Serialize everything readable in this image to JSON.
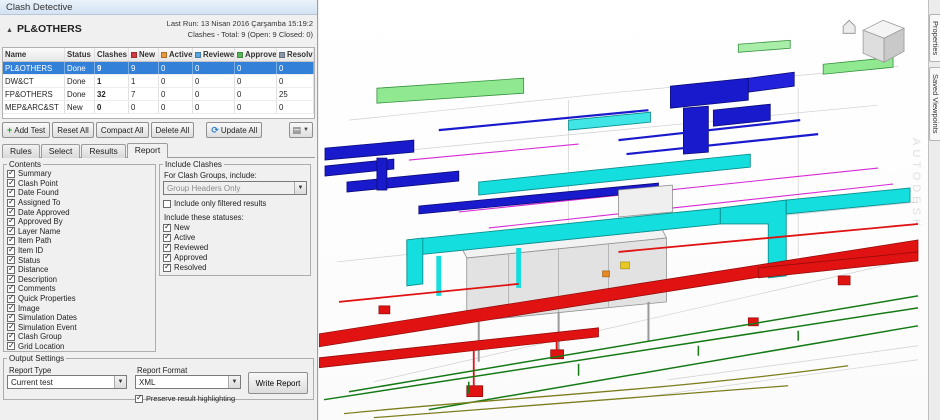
{
  "window": {
    "title": "Clash Detective"
  },
  "header": {
    "collapse_icon": "▲",
    "test_name": "PL&OTHERS",
    "last_run": "Last Run: 13 Nisan 2016 Çarşamba 15:19:2",
    "summary": "Clashes - Total: 9 (Open: 9 Closed: 0)"
  },
  "table": {
    "columns": [
      "Name",
      "Status",
      "Clashes",
      "New",
      "Active",
      "Reviewed",
      "Approved",
      "Resolved"
    ],
    "status_colors": {
      "new": "#d23b3b",
      "active": "#e8973a",
      "reviewed": "#5aa7dd",
      "approved": "#59b75a",
      "resolved": "#8a97a8"
    },
    "rows": [
      {
        "name": "PL&OTHERS",
        "status": "Done",
        "clashes": "9",
        "new": "9",
        "active": "0",
        "reviewed": "0",
        "approved": "0",
        "resolved": "0"
      },
      {
        "name": "DW&CT",
        "status": "Done",
        "clashes": "1",
        "new": "1",
        "active": "0",
        "reviewed": "0",
        "approved": "0",
        "resolved": "0"
      },
      {
        "name": "FP&OTHERS",
        "status": "Done",
        "clashes": "32",
        "new": "7",
        "active": "0",
        "reviewed": "0",
        "approved": "0",
        "resolved": "25"
      },
      {
        "name": "MEP&ARC&ST",
        "status": "New",
        "clashes": "0",
        "new": "0",
        "active": "0",
        "reviewed": "0",
        "approved": "0",
        "resolved": "0"
      }
    ]
  },
  "toolbar": {
    "add_test": "Add Test",
    "reset_all": "Reset All",
    "compact_all": "Compact All",
    "delete_all": "Delete All",
    "update_all": "Update All"
  },
  "tabs": [
    {
      "label": "Rules"
    },
    {
      "label": "Select"
    },
    {
      "label": "Results"
    },
    {
      "label": "Report"
    }
  ],
  "report_tab": {
    "contents": {
      "title": "Contents",
      "items": [
        "Summary",
        "Clash Point",
        "Date Found",
        "Assigned To",
        "Date Approved",
        "Approved By",
        "Layer Name",
        "Item Path",
        "Item ID",
        "Status",
        "Distance",
        "Description",
        "Comments",
        "Quick Properties",
        "Image",
        "Simulation Dates",
        "Simulation Event",
        "Clash Group",
        "Grid Location"
      ]
    },
    "include_clashes": {
      "title": "Include Clashes",
      "group_label": "For Clash Groups, include:",
      "group_value": "Group Headers Only",
      "filtered_label": "Include only filtered results",
      "statuses_label": "Include these statuses:",
      "statuses": [
        "New",
        "Active",
        "Reviewed",
        "Approved",
        "Resolved"
      ]
    },
    "output_settings": {
      "title": "Output Settings",
      "report_type_label": "Report Type",
      "report_type_value": "Current test",
      "report_format_label": "Report Format",
      "report_format_value": "XML",
      "preserve_label": "Preserve result highlighting",
      "write_report_label": "Write Report"
    }
  },
  "viewport": {
    "side_tabs": [
      "Properties",
      "Saved Viewpoints"
    ],
    "watermark": "AUTODESK",
    "model_colors": {
      "duct_cyan": "#15dede",
      "duct_blue": "#1a1acd",
      "pipe_red": "#e01212",
      "pipe_green": "#157a15",
      "duct_lightgreen": "#90e890",
      "structure_gray": "#e2e2e2"
    }
  }
}
